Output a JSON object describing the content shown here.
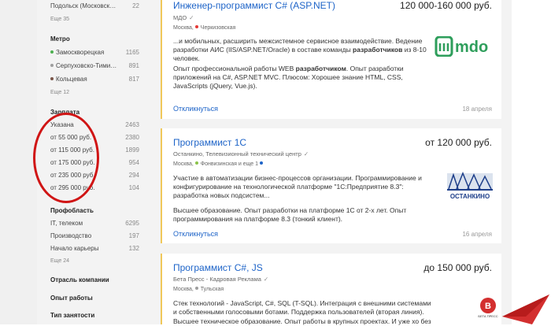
{
  "sidebar": {
    "top_item": {
      "label": "Подольск (Московская о...",
      "count": "22"
    },
    "top_more": "Еще 35",
    "metro_title": "Метро",
    "metro": [
      {
        "label": "Замоскворецкая",
        "count": "1165",
        "color": "#4caf50"
      },
      {
        "label": "Серпуховско-Тимиря...",
        "count": "891",
        "color": "#9e9e9e"
      },
      {
        "label": "Кольцевая",
        "count": "817",
        "color": "#795548"
      }
    ],
    "metro_more": "Еще 12",
    "salary_title": "Зарплата",
    "salary": [
      {
        "label": "Указана",
        "count": "2463"
      },
      {
        "label": "от 55 000 руб.",
        "count": "2380"
      },
      {
        "label": "от 115 000 руб.",
        "count": "1899"
      },
      {
        "label": "от 175 000 руб.",
        "count": "954"
      },
      {
        "label": "от 235 000 руб.",
        "count": "294"
      },
      {
        "label": "от 295 000 руб.",
        "count": "104"
      }
    ],
    "areas_title": "Профобласть",
    "areas": [
      {
        "label": "IT, телеком",
        "count": "6295"
      },
      {
        "label": "Производство",
        "count": "197"
      },
      {
        "label": "Начало карьеры",
        "count": "132"
      }
    ],
    "areas_more": "Еще 24",
    "company_title": "Отрасль компании",
    "experience_title": "Опыт работы",
    "employment_title": "Тип занятости"
  },
  "vacancies": [
    {
      "title": "Инженер-программист C# (ASP.NET)",
      "salary": "120 000-160 000 руб.",
      "company": "МДО",
      "location": "Москва,",
      "metro": "Черкизовская",
      "metro_color": "#e53935",
      "desc1a": "...и мобильных, расширить межсистемное сервисное взаимодействие. Ведение разработки АИС (IIS/ASP.NET/Oracle) в составе команды ",
      "desc1b": "разработчиков",
      "desc1c": " из 8-10 человек.",
      "desc2a": "Опыт профессиональной работы WEB ",
      "desc2b": "разработчиком",
      "desc2c": ". Опыт разработки приложений на C#, ASP.NET MVC. Плюсом: Хорошее знание HTML, CSS, JavaScripts (jQuery, Vue.js).",
      "respond": "Откликнуться",
      "date": "18 апреля",
      "logo_text": "mdo"
    },
    {
      "title": "Программист 1С",
      "salary": "от 120 000 руб.",
      "company": "Останкино, Телевизионный технический центр",
      "location": "Москва,",
      "metro": "Фонвизинская и еще 1",
      "metro_color": "#8bc34a",
      "desc1": "Участие в автоматизации бизнес-процессов организации. Программирование и конфигурирование на технологической платформе \"1С:Предприятие 8.3\": разработка новых подсистем...",
      "desc2": "Высшее образование. Опыт разработки на платформе 1С от 2-х лет. Опыт программирования на платформе 8.3 (тонкий клиент).",
      "respond": "Откликнуться",
      "date": "16 апреля",
      "logo_text": "ОСТАНКИНО"
    },
    {
      "title": "Программист C#, JS",
      "salary": "до 150 000 руб.",
      "company": "Бета Пресс - Кадровая Реклама",
      "location": "Москва,",
      "metro": "Тульская",
      "metro_color": "#9e9e9e",
      "desc1": "Стек технологий - JavaScript, C#, SQL (T-SQL). Интеграция с внешними системами и собственными голосовыми ботами. Поддержка пользователей (вторая линия).",
      "desc2": "Высшее техническое образование. Опыт работы в крупных проектах. И уже хо без",
      "logo_text": "БЕТА ПРЕСС"
    }
  ],
  "colors": {
    "accent": "#1e64c8",
    "annotation": "#d01515",
    "card_border": "#f0c85a"
  }
}
